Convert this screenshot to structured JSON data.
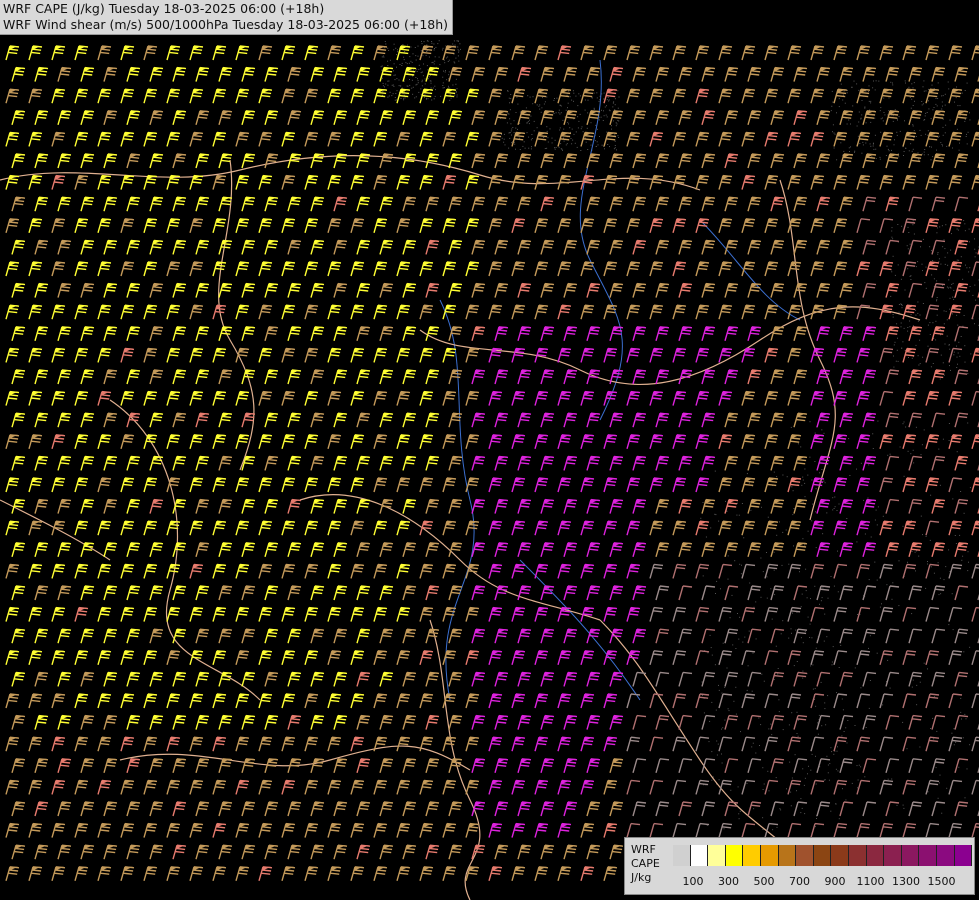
{
  "header": {
    "line1": "WRF CAPE (J/kg) Tuesday 18-03-2025 06:00 (+18h)",
    "line2": "WRF Wind shear (m/s) 500/1000hPa Tuesday 18-03-2025 06:00 (+18h)"
  },
  "legend": {
    "model": "WRF",
    "field": "CAPE",
    "unit": "J/kg",
    "tick_labels": [
      "100",
      "300",
      "500",
      "700",
      "900",
      "1100",
      "1300",
      "1500"
    ],
    "colors": [
      "#d0d0d0",
      "#ffffff",
      "#ffff99",
      "#ffff00",
      "#ffcc00",
      "#e69a00",
      "#b8741a",
      "#a0522d",
      "#8b4513",
      "#8b3a1a",
      "#8b3030",
      "#8b2840",
      "#8b2050",
      "#8b1860",
      "#8b1070",
      "#8b0a80",
      "#8b0090"
    ]
  },
  "map": {
    "barb_colors": {
      "yellow": "#ffff33",
      "tan": "#c49a5a",
      "salmon": "#e77b6e",
      "magenta": "#dd22dd",
      "rose": "#b07070",
      "gray": "#9a8a8a"
    },
    "border_color": "#e0b090",
    "river_color": "#3b6fd0"
  }
}
